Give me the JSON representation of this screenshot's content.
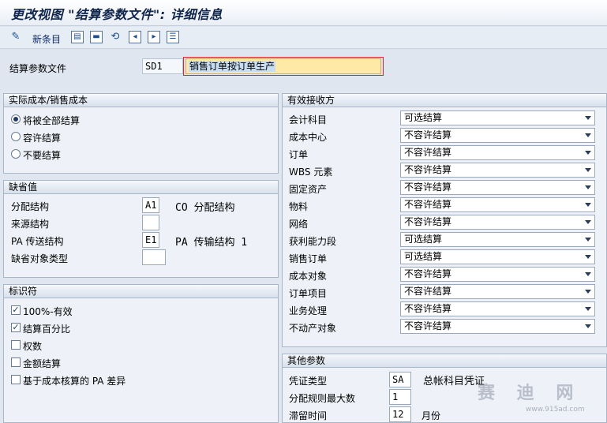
{
  "window": {
    "title": "更改视图 \"结算参数文件\": 详细信息"
  },
  "toolbar": {
    "new_entries_label": "新条目"
  },
  "header": {
    "profile_label": "结算参数文件",
    "profile_code": "SD1",
    "profile_description": "销售订单按订单生产"
  },
  "actual_costs": {
    "title": "实际成本/销售成本",
    "options": [
      {
        "label": "将被全部结算",
        "selected": true
      },
      {
        "label": "容许结算",
        "selected": false
      },
      {
        "label": "不要结算",
        "selected": false
      }
    ]
  },
  "defaults": {
    "title": "缺省值",
    "rows": [
      {
        "label": "分配结构",
        "value": "A1",
        "description": "CO 分配结构"
      },
      {
        "label": "来源结构",
        "value": "",
        "description": ""
      },
      {
        "label": "PA 传送结构",
        "value": "E1",
        "description": "PA 传输结构 1"
      },
      {
        "label": "缺省对象类型",
        "value": "",
        "description": ""
      }
    ]
  },
  "indicators": {
    "title": "标识符",
    "items": [
      {
        "label": "100%-有效",
        "checked": true
      },
      {
        "label": "结算百分比",
        "checked": true
      },
      {
        "label": "权数",
        "checked": false
      },
      {
        "label": "金额结算",
        "checked": false
      },
      {
        "label": "基于成本核算的 PA 差异",
        "checked": false
      }
    ]
  },
  "receivers": {
    "title": "有效接收方",
    "rows": [
      {
        "label": "会计科目",
        "value": "可选结算"
      },
      {
        "label": "成本中心",
        "value": "不容许结算"
      },
      {
        "label": "订单",
        "value": "不容许结算"
      },
      {
        "label": "WBS 元素",
        "value": "不容许结算"
      },
      {
        "label": "固定资产",
        "value": "不容许结算"
      },
      {
        "label": "物料",
        "value": "不容许结算"
      },
      {
        "label": "网络",
        "value": "不容许结算"
      },
      {
        "label": "获利能力段",
        "value": "可选结算"
      },
      {
        "label": "销售订单",
        "value": "可选结算"
      },
      {
        "label": "成本对象",
        "value": "不容许结算"
      },
      {
        "label": "订单项目",
        "value": "不容许结算"
      },
      {
        "label": "业务处理",
        "value": "不容许结算"
      },
      {
        "label": "不动产对象",
        "value": "不容许结算"
      }
    ]
  },
  "other": {
    "title": "其他参数",
    "doc_type_label": "凭证类型",
    "doc_type_value": "SA",
    "doc_type_description": "总帐科目凭证",
    "max_rules_label": "分配规则最大数",
    "max_rules_value": "1",
    "retention_label": "滞留时间",
    "retention_value": "12",
    "retention_unit": "月份"
  },
  "watermark": {
    "text": "赛 迪 网",
    "url": "www.915ad.com"
  },
  "colors": {
    "title_text": "#10254c",
    "background": "#dfe6ef",
    "highlight_field": "#ffe9a6",
    "focus_bracket": "#d9262c"
  }
}
